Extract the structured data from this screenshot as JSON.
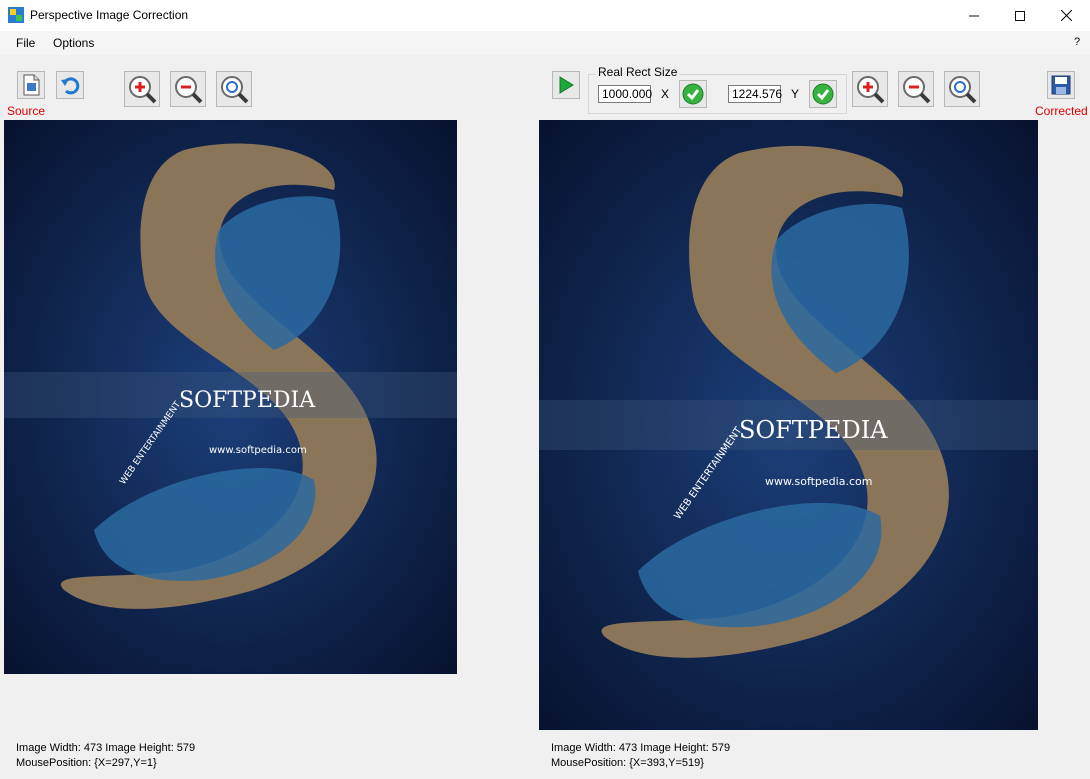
{
  "window": {
    "title": "Perspective Image Correction"
  },
  "menu": {
    "file": "File",
    "options": "Options",
    "help": "?"
  },
  "source": {
    "label": "Source"
  },
  "corrected": {
    "label": "Corrected"
  },
  "rect": {
    "group_label": "Real Rect Size",
    "x_value": "1000.000",
    "x_label": "X",
    "y_value": "1224.576",
    "y_label": "Y"
  },
  "images": {
    "watermark": "SOFTPEDIA",
    "watermark_url": "www.softpedia.com",
    "watermark_sub": "WEB ENTERTAINMENT"
  },
  "left_info": {
    "size": "Image Width: 473 Image Height: 579",
    "mouse": "MousePosition: {X=297,Y=1}"
  },
  "right_info": {
    "size": "Image Width: 473 Image Height: 579",
    "mouse": "MousePosition: {X=393,Y=519}"
  }
}
